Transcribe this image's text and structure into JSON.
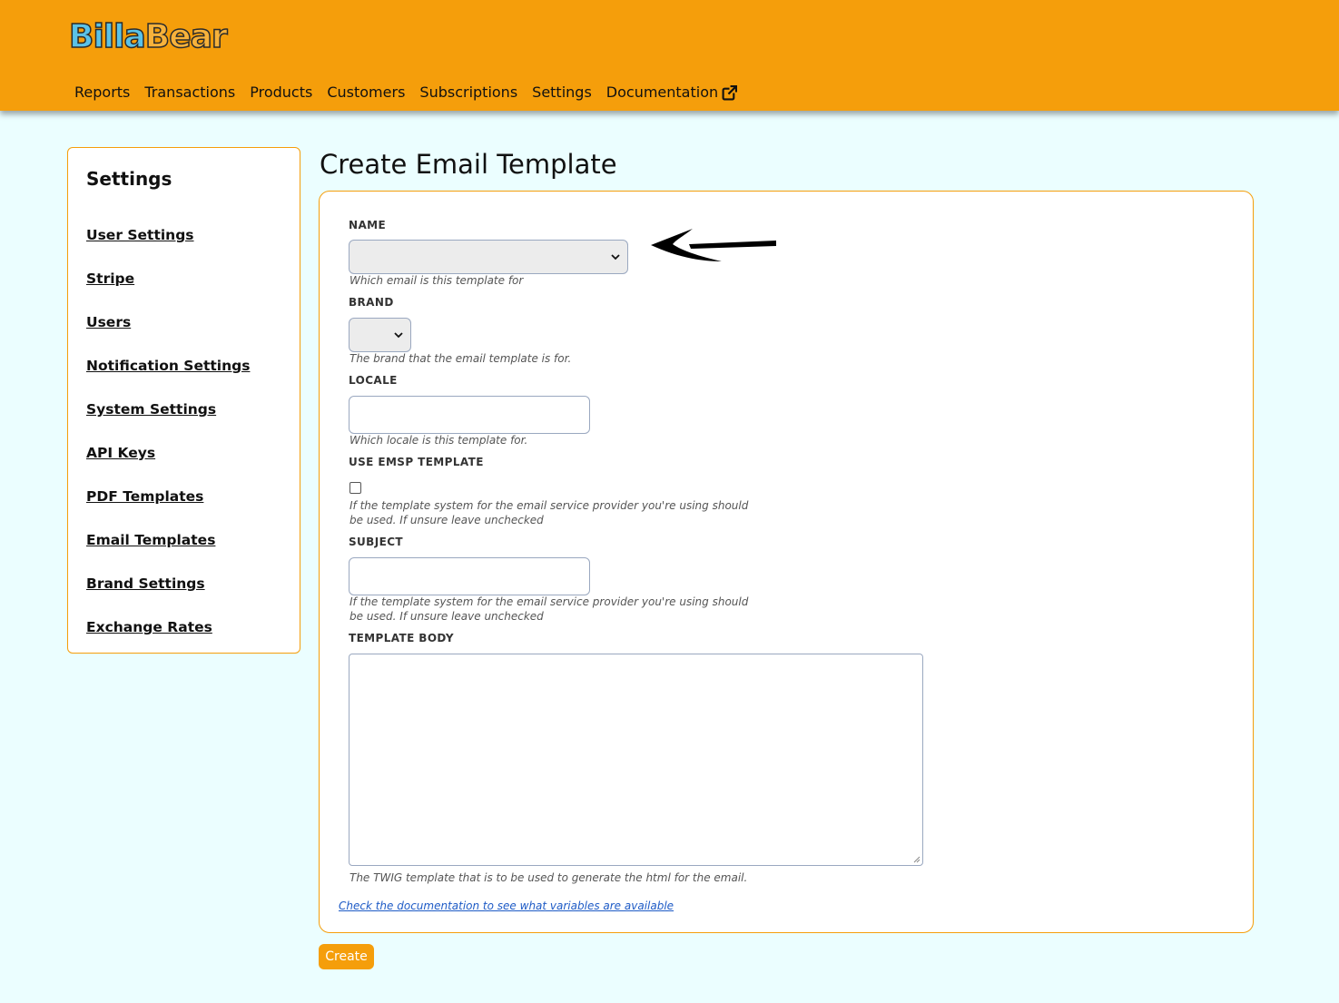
{
  "header": {
    "logo_part1": "Billa",
    "logo_part2": "Bear",
    "nav": [
      "Reports",
      "Transactions",
      "Products",
      "Customers",
      "Subscriptions",
      "Settings",
      "Documentation"
    ]
  },
  "sidebar": {
    "title": "Settings",
    "items": [
      "User Settings",
      "Stripe",
      "Users",
      "Notification Settings",
      "System Settings",
      "API Keys",
      "PDF Templates",
      "Email Templates",
      "Brand Settings",
      "Exchange Rates"
    ]
  },
  "main": {
    "title": "Create Email Template",
    "fields": {
      "name": {
        "label": "NAME",
        "help": "Which email is this template for",
        "value": ""
      },
      "brand": {
        "label": "BRAND",
        "help": "The brand that the email template is for.",
        "value": ""
      },
      "locale": {
        "label": "LOCALE",
        "help": "Which locale is this template for.",
        "value": ""
      },
      "use_emsp": {
        "label": "USE EMSP TEMPLATE",
        "help": "If the template system for the email service provider you're using should be used. If unsure leave unchecked",
        "checked": false
      },
      "subject": {
        "label": "SUBJECT",
        "help": "If the template system for the email service provider you're using should be used. If unsure leave unchecked",
        "value": ""
      },
      "template_body": {
        "label": "TEMPLATE BODY",
        "help": "The TWIG template that is to be used to generate the html for the email.",
        "value": ""
      }
    },
    "doc_link": "Check the documentation to see what variables are available",
    "create_label": "Create"
  },
  "colors": {
    "accent": "#f59e0b",
    "background": "#ebfeff",
    "link": "#1e5bc6"
  }
}
